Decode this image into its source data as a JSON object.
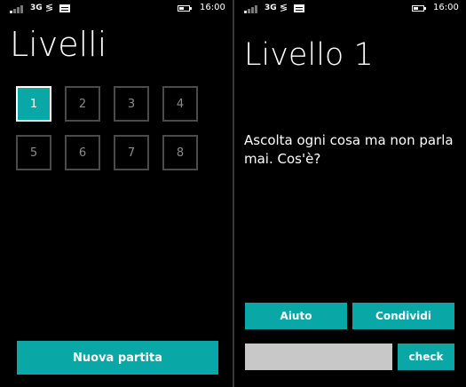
{
  "status_bar": {
    "network": "3G",
    "data_glyph": "≶",
    "time": "16:00",
    "icons": [
      "signal-icon",
      "data-icon",
      "message-icon",
      "battery-icon"
    ]
  },
  "levels_screen": {
    "title": "Livelli",
    "levels": [
      "1",
      "2",
      "3",
      "4",
      "5",
      "6",
      "7",
      "8"
    ],
    "selected_level": "1",
    "new_game_label": "Nuova partita"
  },
  "level_screen": {
    "title": "Livello 1",
    "riddle": "Ascolta ogni cosa ma non parla mai. Cos'è?",
    "help_label": "Aiuto",
    "share_label": "Condividi",
    "answer_value": "",
    "check_label": "check"
  },
  "colors": {
    "accent": "#0aa7a7",
    "background": "#000000",
    "input": "#c8c8c8"
  }
}
